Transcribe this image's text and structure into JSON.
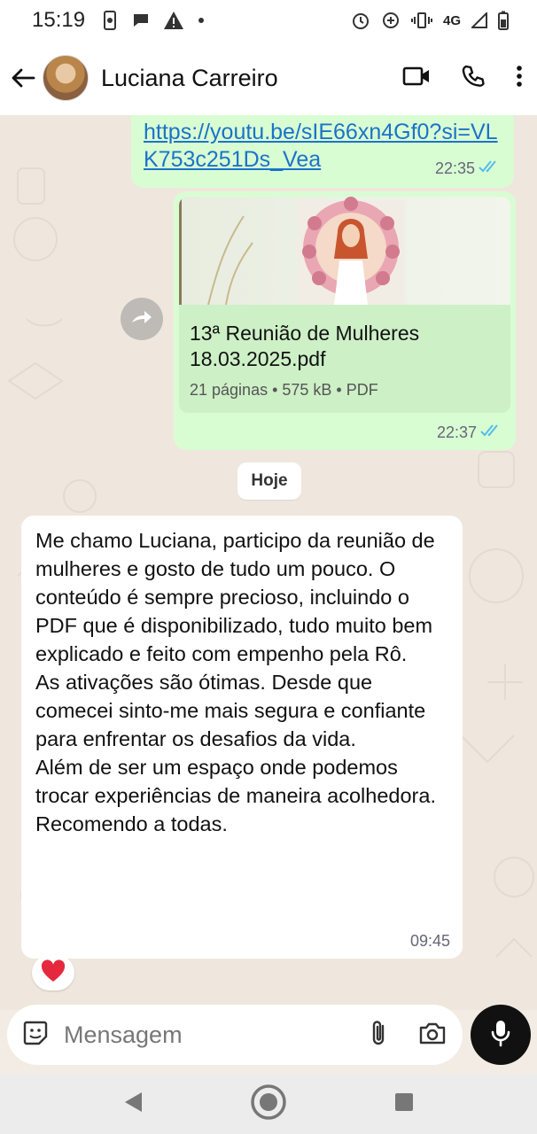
{
  "status_bar": {
    "time": "15:19",
    "network": "4G"
  },
  "header": {
    "contact_name": "Luciana Carreiro"
  },
  "messages": [
    {
      "type": "link",
      "text": "https://youtu.be/sIE66xn4Gf0?si=VLK753c251Ds_Vea",
      "time": "22:35"
    },
    {
      "type": "document",
      "title": "13ª Reunião de Mulheres 18.03.2025.pdf",
      "info": "21 páginas • 575 kB • PDF",
      "time": "22:37"
    }
  ],
  "date_separator": "Hoje",
  "incoming_message": {
    "text": "Me chamo Luciana, participo da reunião de mulheres e gosto de tudo um pouco. O  conteúdo é sempre precioso, incluindo o PDF que é disponibilizado, tudo muito bem explicado e feito com empenho pela Rô.\nAs ativações são ótimas. Desde que comecei sinto-me mais segura e confiante para enfrentar os desafios da vida.\nAlém de ser um espaço onde podemos trocar experiências de maneira acolhedora.\nRecomendo a todas.",
    "time": "09:45",
    "reaction": "❤️"
  },
  "composer": {
    "placeholder": "Mensagem"
  },
  "colors": {
    "outgoing_bubble": "#d9fdd3",
    "incoming_bubble": "#ffffff",
    "read_ticks": "#53bdeb",
    "link": "#1a73c9"
  }
}
